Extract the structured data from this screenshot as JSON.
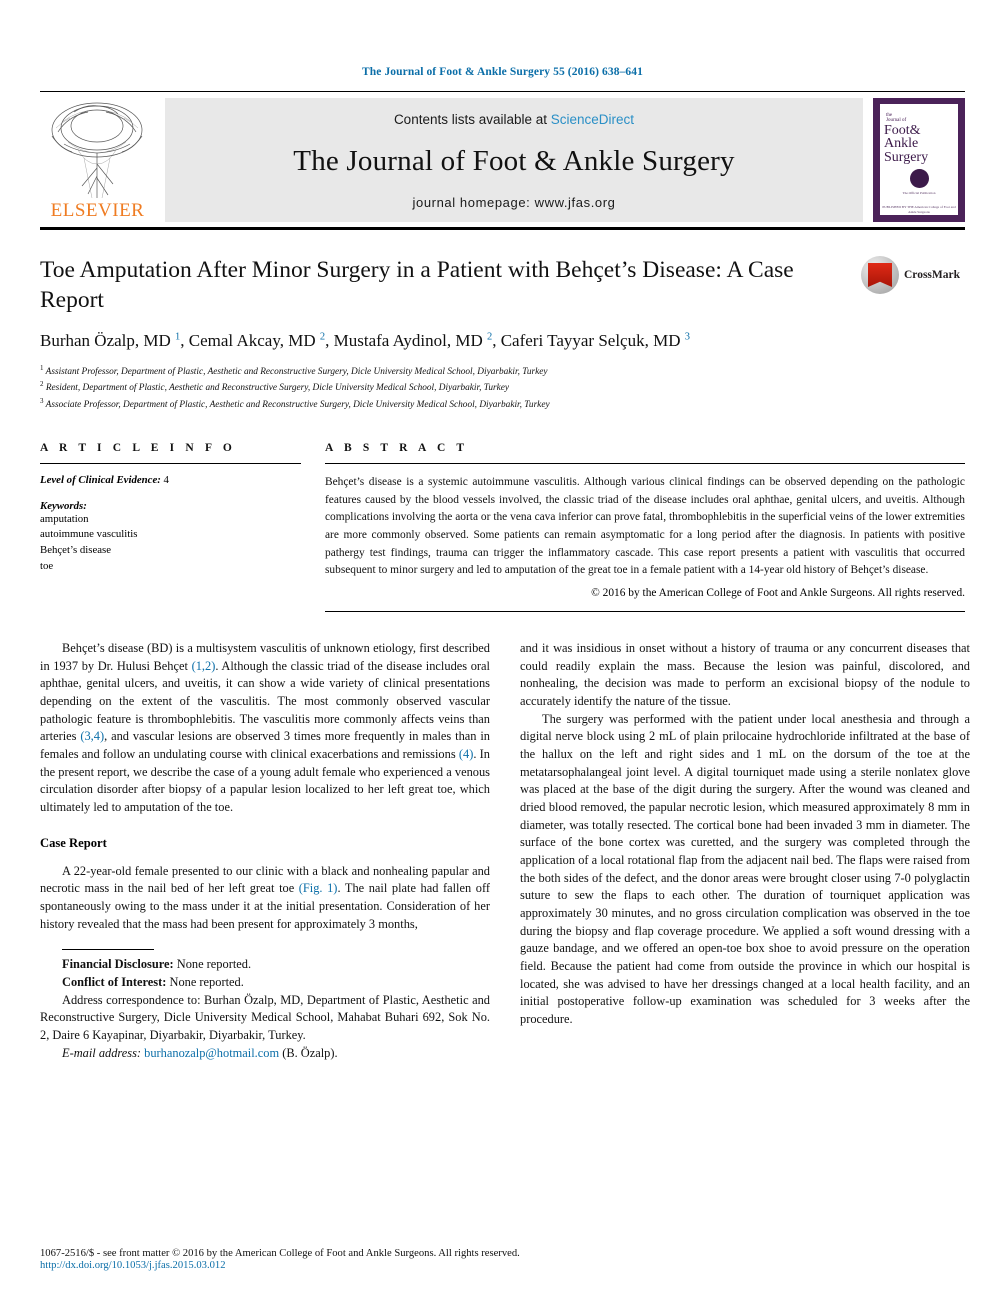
{
  "running_head": "The Journal of Foot & Ankle Surgery 55 (2016) 638–641",
  "masthead": {
    "publisher": "ELSEVIER",
    "contents_prefix": "Contents lists available at ",
    "sciencedirect": "ScienceDirect",
    "journal_title": "The Journal of Foot & Ankle Surgery",
    "homepage": "journal homepage: www.jfas.org",
    "cover": {
      "the": "the",
      "journal": "Journal of",
      "line1": "Foot&",
      "line2": "Ankle",
      "line3": "Surgery",
      "small": "The Official Publication",
      "foot": "PUBLISHED BY THE American College of Foot and Ankle Surgeons"
    }
  },
  "article": {
    "title": "Toe Amputation After Minor Surgery in a Patient with Behçet’s Disease: A Case Report",
    "authors_html": "Burhan Özalp, MD <sup>1</sup>, Cemal Akcay, MD <sup>2</sup>, Mustafa Aydinol, MD <sup>2</sup>, Caferi Tayyar Selçuk, MD <sup>3</sup>",
    "affiliations": [
      "Assistant Professor, Department of Plastic, Aesthetic and Reconstructive Surgery, Dicle University Medical School, Diyarbakir, Turkey",
      "Resident, Department of Plastic, Aesthetic and Reconstructive Surgery, Dicle University Medical School, Diyarbakir, Turkey",
      "Associate Professor, Department of Plastic, Aesthetic and Reconstructive Surgery, Dicle University Medical School, Diyarbakir, Turkey"
    ],
    "crossmark_label": "CrossMark"
  },
  "article_info": {
    "heading": "A R T I C L E   I N F O",
    "level_label": "Level of Clinical Evidence:",
    "level_value": "4",
    "keywords_label": "Keywords:",
    "keywords": [
      "amputation",
      "autoimmune vasculitis",
      "Behçet’s disease",
      "toe"
    ]
  },
  "abstract": {
    "heading": "A B S T R A C T",
    "text": "Behçet’s disease is a systemic autoimmune vasculitis. Although various clinical findings can be observed depending on the pathologic features caused by the blood vessels involved, the classic triad of the disease includes oral aphthae, genital ulcers, and uveitis. Although complications involving the aorta or the vena cava inferior can prove fatal, thrombophlebitis in the superficial veins of the lower extremities are more commonly observed. Some patients can remain asymptomatic for a long period after the diagnosis. In patients with positive pathergy test findings, trauma can trigger the inflammatory cascade. This case report presents a patient with vasculitis that occurred subsequent to minor surgery and led to amputation of the great toe in a female patient with a 14-year old history of Behçet’s disease.",
    "copyright": "© 2016 by the American College of Foot and Ankle Surgeons. All rights reserved."
  },
  "body": {
    "left": {
      "intro_html": "Behçet’s disease (BD) is a multisystem vasculitis of unknown etiology, first described in 1937 by Dr. Hulusi Behçet <span class=\"ref\">(1,2)</span>. Although the classic triad of the disease includes oral aphthae, genital ulcers, and uveitis, it can show a wide variety of clinical presentations depending on the extent of the vasculitis. The most commonly observed vascular pathologic feature is thrombophlebitis. The vasculitis more commonly affects veins than arteries <span class=\"ref\">(3,4)</span>, and vascular lesions are observed 3 times more frequently in males than in females and follow an undulating course with clinical exacerbations and remissions <span class=\"ref\">(4)</span>. In the present report, we describe the case of a young adult female who experienced a venous circulation disorder after biopsy of a papular lesion localized to her left great toe, which ultimately led to amputation of the toe.",
      "case_heading": "Case Report",
      "case_html": "A 22-year-old female presented to our clinic with a black and nonhealing papular and necrotic mass in the nail bed of her left great toe <span class=\"ref\">(Fig. 1)</span>. The nail plate had fallen off spontaneously owing to the mass under it at the initial presentation. Consideration of her history revealed that the mass had been present for approximately 3 months,"
    },
    "right": {
      "p1": "and it was insidious in onset without a history of trauma or any concurrent diseases that could readily explain the mass. Because the lesion was painful, discolored, and nonhealing, the decision was made to perform an excisional biopsy of the nodule to accurately identify the nature of the tissue.",
      "p2": "The surgery was performed with the patient under local anesthesia and through a digital nerve block using 2 mL of plain prilocaine hydrochloride infiltrated at the base of the hallux on the left and right sides and 1 mL on the dorsum of the toe at the metatarsophalangeal joint level. A digital tourniquet made using a sterile nonlatex glove was placed at the base of the digit during the surgery. After the wound was cleaned and dried blood removed, the papular necrotic lesion, which measured approximately 8 mm in diameter, was totally resected. The cortical bone had been invaded 3 mm in diameter. The surface of the bone cortex was curetted, and the surgery was completed through the application of a local rotational flap from the adjacent nail bed. The flaps were raised from the both sides of the defect, and the donor areas were brought closer using 7-0 polyglactin suture to sew the flaps to each other. The duration of tourniquet application was approximately 30 minutes, and no gross circulation complication was observed in the toe during the biopsy and flap coverage procedure. We applied a soft wound dressing with a gauze bandage, and we offered an open-toe box shoe to avoid pressure on the operation field. Because the patient had come from outside the province in which our hospital is located, she was advised to have her dressings changed at a local health facility, and an initial postoperative follow-up examination was scheduled for 3 weeks after the procedure."
    }
  },
  "footnotes": {
    "financial_label": "Financial Disclosure:",
    "financial_value": "None reported.",
    "conflict_label": "Conflict of Interest:",
    "conflict_value": "None reported.",
    "address": "Address correspondence to: Burhan Özalp, MD, Department of Plastic, Aesthetic and Reconstructive Surgery, Dicle University Medical School, Mahabat Buhari 692, Sok No. 2, Daire 6 Kayapinar, Diyarbakir, Diyarbakir, Turkey.",
    "email_label": "E-mail address:",
    "email": "burhanozalp@hotmail.com",
    "email_suffix": "(B. Özalp)."
  },
  "bottom": {
    "issn": "1067-2516/$ - see front matter © 2016 by the American College of Foot and Ankle Surgeons. All rights reserved.",
    "doi": "http://dx.doi.org/10.1053/j.jfas.2015.03.012"
  },
  "colors": {
    "link": "#0b6ea8",
    "sciencedirect": "#2a8fc6",
    "elsevier_orange": "#ef7c22",
    "cover_purple": "#4b2259"
  }
}
